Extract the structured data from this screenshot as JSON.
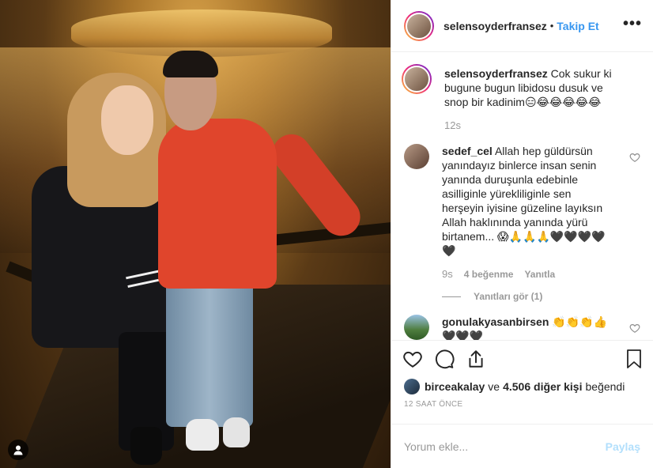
{
  "header": {
    "username": "selensoyderfransez",
    "separator": "•",
    "follow_label": "Takip Et",
    "more_glyph": "•••"
  },
  "caption": {
    "username": "selensoyderfransez",
    "text": "Cok sukur ki bugune bugun libidosu dusuk ve snop bir kadinim😑😂😂😂😂😂",
    "time": "12s"
  },
  "comments": [
    {
      "username": "sedef_cel",
      "text": "Allah hep güldürsün yanındayız binlerce insan senin yanında duruşunla edebinle asilliginle yürekliliginle sen herşeyin iyisine güzeline layıksın Allah haklınında yanında yürü birtanem... 😱🙏🙏🙏🖤🖤🖤🖤🖤",
      "time": "9s",
      "likes": "4 beğenme",
      "reply": "Yanıtla",
      "view_replies": "Yanıtları gör (1)"
    },
    {
      "username": "gonulakyasanbirsen",
      "text": "👏👏👏👍🖤🖤🖤"
    }
  ],
  "icons": {
    "heart": "heart-icon",
    "comment": "comment-icon",
    "share": "share-icon",
    "bookmark": "bookmark-icon",
    "user_tag": "user-tag-icon"
  },
  "likes": {
    "first_user": "birceakalay",
    "connector": "ve",
    "count_text": "4.506 diğer kişi",
    "suffix": "beğendi"
  },
  "timestamp": "12 SAAT ÖNCE",
  "add_comment": {
    "placeholder": "Yorum ekle...",
    "post_label": "Paylaş"
  },
  "colors": {
    "link_blue": "#3897f0",
    "post_disabled": "#b2dffc",
    "muted": "#999999",
    "text": "#262626"
  }
}
